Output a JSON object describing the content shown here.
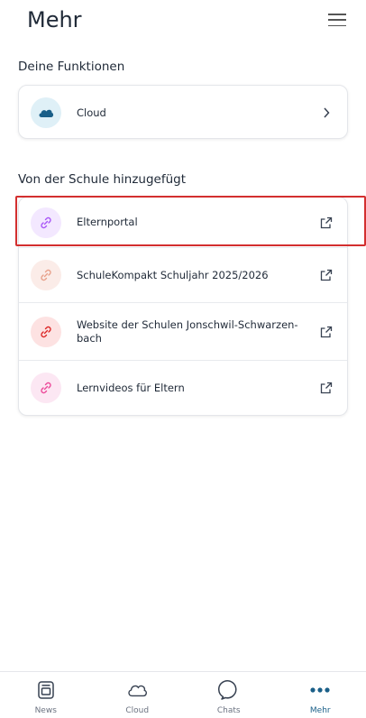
{
  "header": {
    "title": "Mehr"
  },
  "functions": {
    "title": "Deine Funktionen",
    "items": [
      {
        "label": "Cloud",
        "icon": "cloud-icon"
      }
    ]
  },
  "school": {
    "title": "Von der Schule hinzugefügt",
    "items": [
      {
        "label": "Elternportal",
        "icon": "link-icon",
        "color": "#a855f7",
        "bg": "#f3e8ff"
      },
      {
        "label": "SchuleKompakt Schuljahr 2025/2026",
        "icon": "link-icon",
        "color": "#e8a08a",
        "bg": "#fbece8"
      },
      {
        "label": "Website der Schulen Jonschwil-Schwarzen-bach",
        "icon": "link-icon",
        "color": "#dc2626",
        "bg": "#fde2e2"
      },
      {
        "label": "Lernvideos für Eltern",
        "icon": "link-icon",
        "color": "#ec4899",
        "bg": "#fce7f3"
      }
    ]
  },
  "tabs": [
    {
      "label": "News",
      "icon": "news-icon"
    },
    {
      "label": "Cloud",
      "icon": "cloud-outline-icon"
    },
    {
      "label": "Chats",
      "icon": "chat-icon"
    },
    {
      "label": "Mehr",
      "icon": "more-dots-icon",
      "active": true
    }
  ],
  "colors": {
    "accent": "#1a5f88",
    "highlight": "#d32f2f"
  }
}
